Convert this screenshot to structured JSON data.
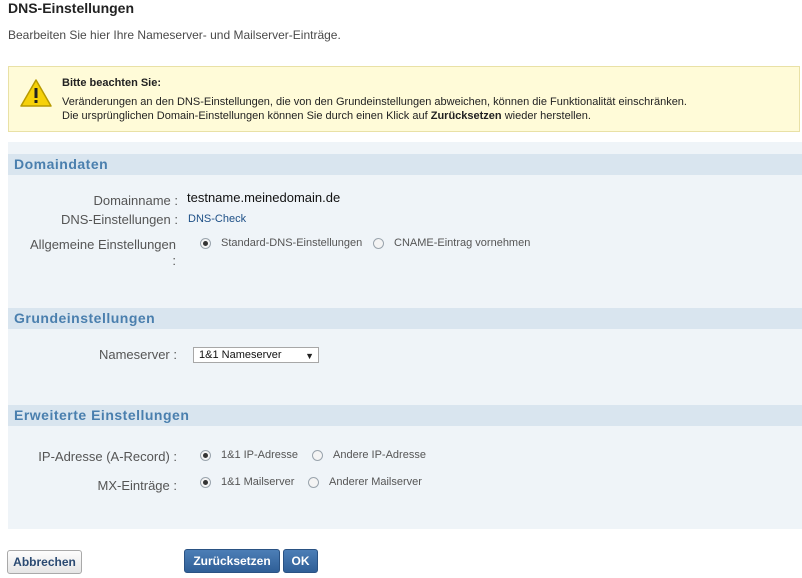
{
  "header": {
    "title": "DNS-Einstellungen",
    "subtitle": "Bearbeiten Sie hier Ihre Nameserver- und Mailserver-Einträge."
  },
  "notice": {
    "icon": "warning-icon",
    "title": "Bitte beachten Sie:",
    "line1": "Veränderungen an den DNS-Einstellungen, die von den Grundeinstellungen abweichen, können die Funktionalität einschränken.",
    "line2_prefix": "Die ursprünglichen Domain-Einstellungen können Sie durch einen Klick auf ",
    "line2_bold": "Zurücksetzen",
    "line2_suffix": " wieder herstellen."
  },
  "domaindaten": {
    "header": "Domaindaten",
    "domainname_label": "Domainname :",
    "domainname_value": "testname.meinedomain.de",
    "dns_label": "DNS-Einstellungen :",
    "dns_link": "DNS-Check",
    "allgemeine_label": "Allgemeine Einstellungen",
    "allgemeine_colon": ":",
    "options": [
      {
        "label": "Standard-DNS-Einstellungen",
        "checked": true
      },
      {
        "label": "CNAME-Eintrag vornehmen",
        "checked": false
      }
    ]
  },
  "grundeinstellungen": {
    "header": "Grundeinstellungen",
    "nameserver_label": "Nameserver :",
    "nameserver_value": "1&1 Nameserver"
  },
  "erweiterte": {
    "header": "Erweiterte Einstellungen",
    "ip_label": "IP-Adresse (A-Record) :",
    "ip_options": [
      {
        "label": "1&1 IP-Adresse",
        "checked": true
      },
      {
        "label": "Andere IP-Adresse",
        "checked": false
      }
    ],
    "mx_label": "MX-Einträge :",
    "mx_options": [
      {
        "label": "1&1 Mailserver",
        "checked": true
      },
      {
        "label": "Anderer Mailserver",
        "checked": false
      }
    ]
  },
  "buttons": {
    "cancel": "Abbrechen",
    "reset": "Zurücksetzen",
    "ok": "OK"
  },
  "colors": {
    "section_header_bg": "#d9e5ef",
    "section_header_text": "#4a7fae",
    "notice_bg": "#fffbd8",
    "primary_button": "#3a6aa3"
  }
}
